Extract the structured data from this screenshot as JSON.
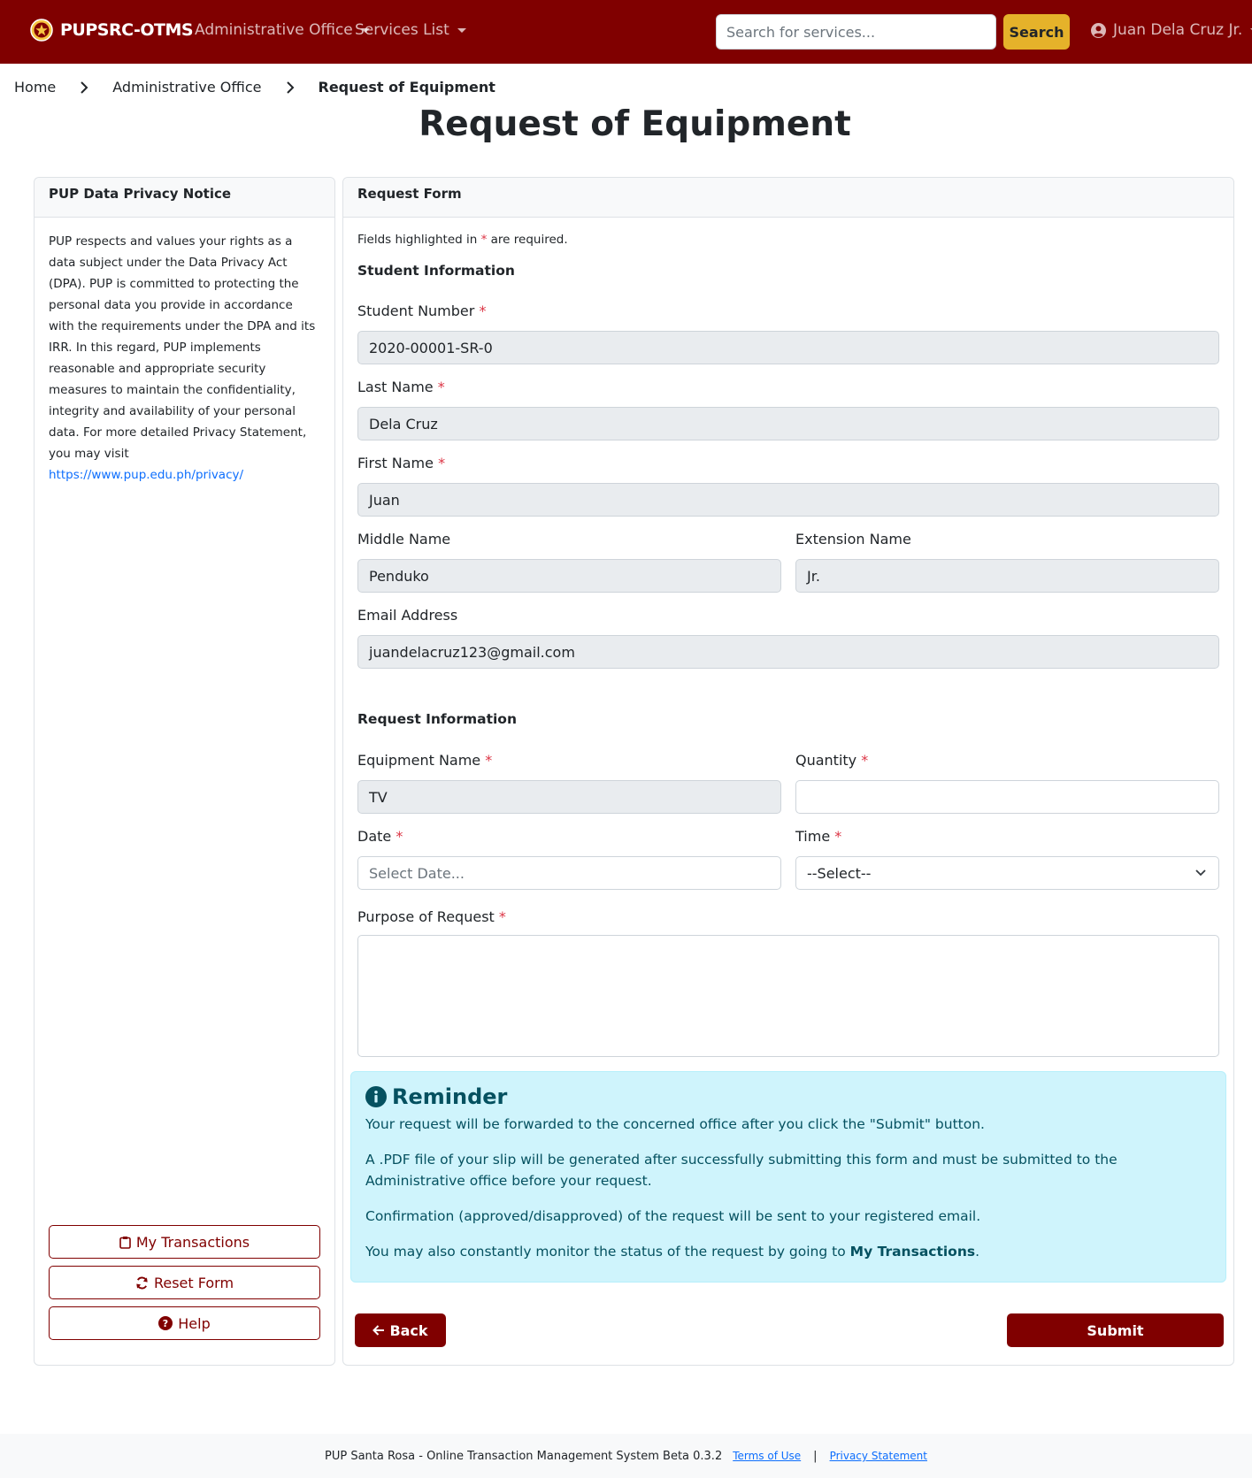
{
  "navbar": {
    "brand": "PUPSRC-OTMS",
    "admin_office": "Administrative Office",
    "services_list": "Services List",
    "search_placeholder": "Search for services...",
    "search_button": "Search",
    "user_name": "Juan Dela Cruz Jr."
  },
  "breadcrumb": {
    "home": "Home",
    "office": "Administrative Office",
    "current": "Request of Equipment"
  },
  "page_title": "Request of Equipment",
  "privacy": {
    "header": "PUP Data Privacy Notice",
    "body": "PUP respects and values your rights as a data subject under the Data Privacy Act (DPA). PUP is committed to protecting the personal data you provide in accordance with the requirements under the DPA and its IRR. In this regard, PUP implements reasonable and appropriate security measures to maintain the confidentiality, integrity and availability of your personal data. For more detailed Privacy Statement, you may visit",
    "link": "https://www.pup.edu.ph/privacy/",
    "btn_transactions": "My Transactions",
    "btn_reset": "Reset Form",
    "btn_help": "Help"
  },
  "form": {
    "header": "Request Form",
    "required_prefix": "Fields highlighted in",
    "required_star": "*",
    "required_suffix": "are required.",
    "student_section": "Student Information",
    "student_number_label": "Student Number",
    "student_number": "2020-00001-SR-0",
    "last_name_label": "Last Name",
    "last_name": "Dela Cruz",
    "first_name_label": "First Name",
    "first_name": "Juan",
    "middle_name_label": "Middle Name",
    "middle_name": "Penduko",
    "extension_label": "Extension Name",
    "extension": "Jr.",
    "email_label": "Email Address",
    "email": "juandelacruz123@gmail.com",
    "request_section": "Request Information",
    "equipment_label": "Equipment Name",
    "equipment": "TV",
    "quantity_label": "Quantity",
    "quantity": "",
    "date_label": "Date",
    "date_placeholder": "Select Date...",
    "time_label": "Time",
    "time_selected": "--Select--",
    "purpose_label": "Purpose of Request",
    "purpose": ""
  },
  "reminder": {
    "title": "Reminder",
    "p1": "Your request will be forwarded to the concerned office after you click the \"Submit\" button.",
    "p2": "A .PDF file of your slip will be generated after successfully submitting this form and must be submitted to the Administrative office before your request.",
    "p3": "Confirmation (approved/disapproved) of the request will be sent to your registered email.",
    "p4_prefix": "You may also constantly monitor the status of the request by going to",
    "p4_link": "My Transactions",
    "p4_suffix": "."
  },
  "buttons": {
    "back": "Back",
    "submit": "Submit"
  },
  "footer": {
    "text": "PUP Santa Rosa - Online Transaction Management System Beta 0.3.2",
    "terms": "Terms of Use",
    "separator": "|",
    "privacy": "Privacy Statement"
  },
  "colors": {
    "brand": "#800000",
    "search_button": "#e5b22a",
    "reminder_bg": "#cff4fc",
    "required": "#dc3545"
  }
}
